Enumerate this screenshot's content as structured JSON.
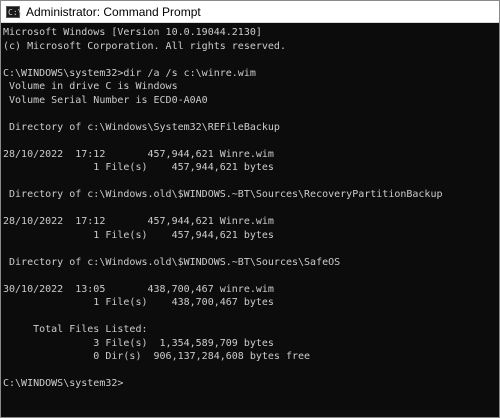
{
  "window": {
    "title": "Administrator: Command Prompt"
  },
  "console": {
    "lines": [
      "Microsoft Windows [Version 10.0.19044.2130]",
      "(c) Microsoft Corporation. All rights reserved.",
      "",
      "C:\\WINDOWS\\system32>dir /a /s c:\\winre.wim",
      " Volume in drive C is Windows",
      " Volume Serial Number is ECD0-A0A0",
      "",
      " Directory of c:\\Windows\\System32\\REFileBackup",
      "",
      "28/10/2022  17:12       457,944,621 Winre.wim",
      "               1 File(s)    457,944,621 bytes",
      "",
      " Directory of c:\\Windows.old\\$WINDOWS.~BT\\Sources\\RecoveryPartitionBackup",
      "",
      "28/10/2022  17:12       457,944,621 Winre.wim",
      "               1 File(s)    457,944,621 bytes",
      "",
      " Directory of c:\\Windows.old\\$WINDOWS.~BT\\Sources\\SafeOS",
      "",
      "30/10/2022  13:05       438,700,467 winre.wim",
      "               1 File(s)    438,700,467 bytes",
      "",
      "     Total Files Listed:",
      "               3 File(s)  1,354,589,709 bytes",
      "               0 Dir(s)  906,137,284,608 bytes free",
      "",
      "C:\\WINDOWS\\system32>"
    ]
  }
}
